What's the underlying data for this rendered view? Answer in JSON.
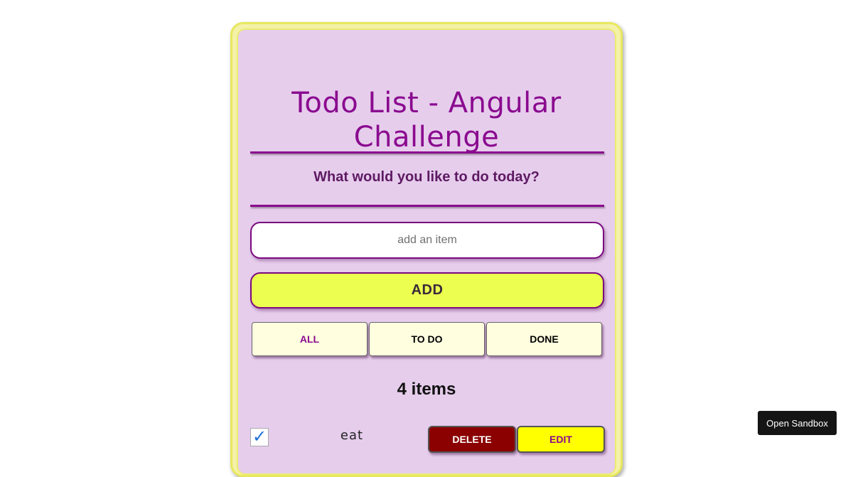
{
  "app": {
    "title": "Todo List - Angular Challenge",
    "subtitle": "What would you like to do today?"
  },
  "input": {
    "placeholder": "add an item",
    "value": ""
  },
  "add_button": {
    "label": "ADD"
  },
  "filters": [
    {
      "label": "ALL",
      "active": true
    },
    {
      "label": "TO DO",
      "active": false
    },
    {
      "label": "DONE",
      "active": false
    }
  ],
  "count_text": "4 items",
  "todos": [
    {
      "text": "eat",
      "done": true,
      "check_mark": "✓",
      "delete_label": "DELETE",
      "edit_label": "EDIT"
    }
  ],
  "sandbox_button": {
    "label": "Open Sandbox"
  },
  "colors": {
    "accent": "#8a0a8f",
    "card_background": "#e6cdec",
    "card_border": "#e8e860",
    "add_button": "#ecff50",
    "filter_button": "#ffffe0",
    "delete_button": "#8b0000",
    "edit_button": "#ffff00"
  },
  "icons": {
    "checkbox": "checkmark-icon"
  }
}
